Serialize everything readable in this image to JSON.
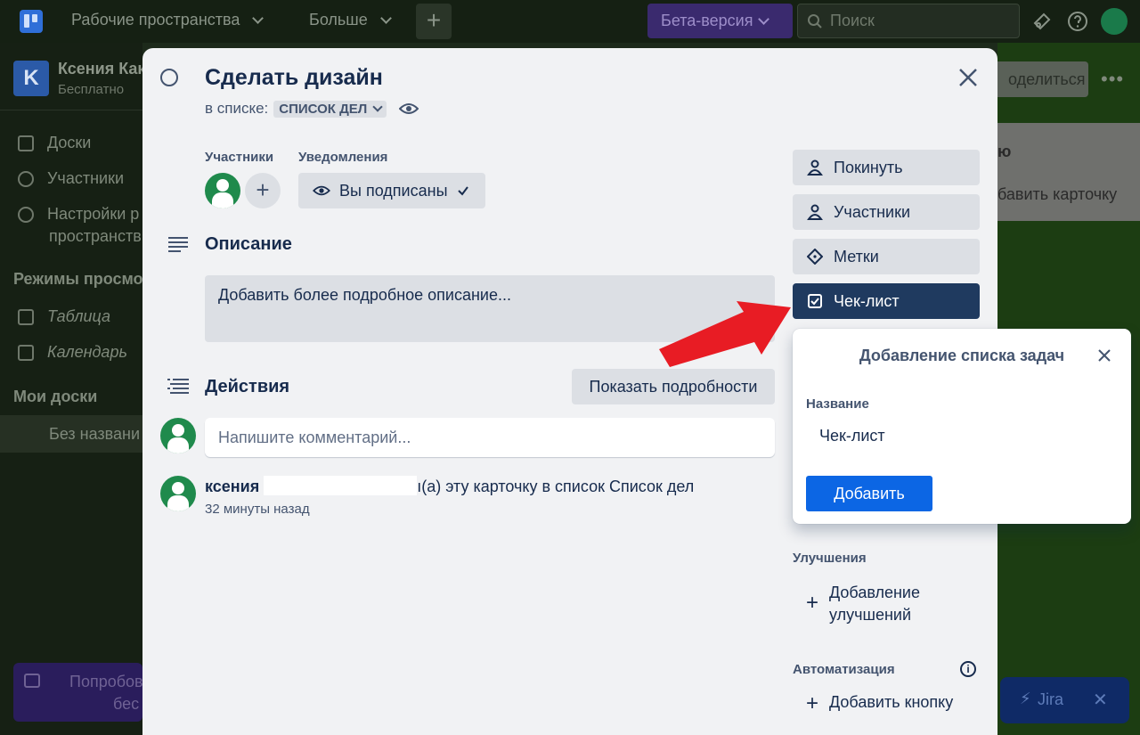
{
  "topbar": {
    "workspaces_label": "Рабочие пространства",
    "more_label": "Больше",
    "beta_label": "Бета-версия",
    "search_placeholder": "Поиск"
  },
  "sidebar": {
    "workspace_initial": "K",
    "workspace_name": "Ксения Как",
    "workspace_plan": "Бесплатно",
    "items": [
      {
        "label": "Доски"
      },
      {
        "label": "Участники"
      },
      {
        "label": "Настройки р"
      },
      {
        "label": "пространств"
      }
    ],
    "views_heading": "Режимы просмо",
    "views": [
      {
        "label": "Таблица"
      },
      {
        "label": "Календарь"
      }
    ],
    "boards_heading": "Мои доски",
    "board_item": "Без названи",
    "promo_line1": "Попробов",
    "promo_line2": "бес"
  },
  "board": {
    "share_label": "оделиться",
    "column_title": "ю",
    "add_card_label": "обавить карточку",
    "jira_label": "Jira"
  },
  "card": {
    "title": "Сделать дизайн",
    "in_list_prefix": "в списке:",
    "list_name": "СПИСОК ДЕЛ",
    "members_label": "Участники",
    "notifications_label": "Уведомления",
    "watch_label": "Вы подписаны",
    "description_title": "Описание",
    "description_placeholder": "Добавить более подробное описание...",
    "activity_title": "Действия",
    "show_details_label": "Показать подробности",
    "comment_placeholder": "Напишите комментарий...",
    "activity_user": "ксения",
    "activity_text": "ı(а) эту карточку в список Список дел",
    "activity_time": "32 минуты назад"
  },
  "actions": {
    "leave": "Покинуть",
    "members": "Участники",
    "labels": "Метки",
    "checklist": "Чек-лист",
    "powerups_heading": "Улучшения",
    "add_powerups_line1": "Добавление",
    "add_powerups_line2": "улучшений",
    "automation_heading": "Автоматизация",
    "add_button": "Добавить кнопку"
  },
  "popover": {
    "title": "Добавление списка задач",
    "name_label": "Название",
    "name_value": "Чек-лист",
    "add_label": "Добавить"
  },
  "colors": {
    "primary": "#0c66e4",
    "active_action": "#1f3a5f",
    "member_avatar": "#1f8a4c",
    "annotation_arrow": "#e81c24"
  },
  "icons": [
    "board-logo-icon",
    "chevron-down-icon",
    "plus-icon",
    "search-icon",
    "megaphone-icon",
    "help-icon",
    "circle-icon",
    "eye-icon",
    "check-icon",
    "close-icon",
    "description-icon",
    "activity-icon",
    "user-icon",
    "tag-icon",
    "checkbox-icon",
    "info-icon",
    "arrow-annotation-icon"
  ]
}
